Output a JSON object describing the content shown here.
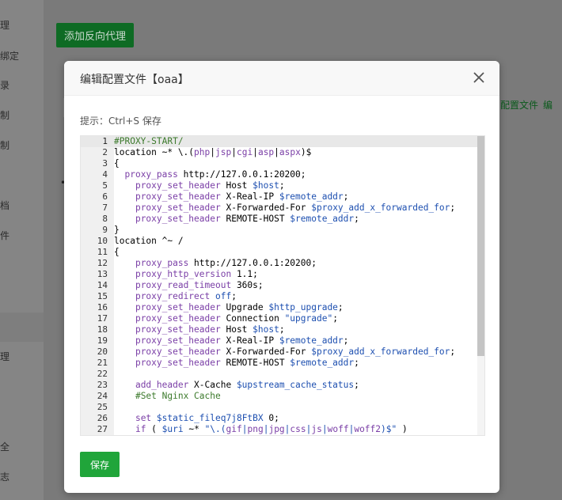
{
  "background": {
    "sidebar_items": [
      "理",
      "绑定",
      "录",
      "制",
      "制",
      "",
      "档",
      "件",
      "理",
      "全",
      "志"
    ],
    "add_button": "添加反向代理",
    "links": [
      "配置文件",
      "编"
    ],
    "bullet": "•"
  },
  "modal": {
    "title": "编辑配置文件【oaa】",
    "hint": "提示：Ctrl+S 保存",
    "save_label": "保存"
  },
  "editor": {
    "active_line": 1,
    "lines": [
      [
        [
          "cmt",
          "#PROXY-START/"
        ]
      ],
      [
        [
          "t",
          "location ~* \\.("
        ],
        [
          "kw",
          "php"
        ],
        [
          "t",
          "|"
        ],
        [
          "kw",
          "jsp"
        ],
        [
          "t",
          "|"
        ],
        [
          "kw",
          "cgi"
        ],
        [
          "t",
          "|"
        ],
        [
          "kw",
          "asp"
        ],
        [
          "t",
          "|"
        ],
        [
          "kw",
          "aspx"
        ],
        [
          "t",
          ")$"
        ]
      ],
      [
        [
          "t",
          "{"
        ]
      ],
      [
        [
          "t",
          "  "
        ],
        [
          "kw",
          "proxy_pass"
        ],
        [
          "t",
          " http://127.0.0.1:20200;"
        ]
      ],
      [
        [
          "t",
          "    "
        ],
        [
          "kw",
          "proxy_set_header"
        ],
        [
          "t",
          " Host "
        ],
        [
          "var",
          "$host"
        ],
        [
          "t",
          ";"
        ]
      ],
      [
        [
          "t",
          "    "
        ],
        [
          "kw",
          "proxy_set_header"
        ],
        [
          "t",
          " X-Real-IP "
        ],
        [
          "var",
          "$remote_addr"
        ],
        [
          "t",
          ";"
        ]
      ],
      [
        [
          "t",
          "    "
        ],
        [
          "kw",
          "proxy_set_header"
        ],
        [
          "t",
          " X-Forwarded-For "
        ],
        [
          "var",
          "$proxy_add_x_forwarded_for"
        ],
        [
          "t",
          ";"
        ]
      ],
      [
        [
          "t",
          "    "
        ],
        [
          "kw",
          "proxy_set_header"
        ],
        [
          "t",
          " REMOTE-HOST "
        ],
        [
          "var",
          "$remote_addr"
        ],
        [
          "t",
          ";"
        ]
      ],
      [
        [
          "t",
          "}"
        ]
      ],
      [
        [
          "t",
          "location ^~ /"
        ]
      ],
      [
        [
          "t",
          "{"
        ]
      ],
      [
        [
          "t",
          "    "
        ],
        [
          "kw",
          "proxy_pass"
        ],
        [
          "t",
          " http://127.0.0.1:20200;"
        ]
      ],
      [
        [
          "t",
          "    "
        ],
        [
          "kw",
          "proxy_http_version"
        ],
        [
          "t",
          " 1.1;"
        ]
      ],
      [
        [
          "t",
          "    "
        ],
        [
          "kw",
          "proxy_read_timeout"
        ],
        [
          "t",
          " 360s;"
        ]
      ],
      [
        [
          "t",
          "    "
        ],
        [
          "kw",
          "proxy_redirect"
        ],
        [
          "t",
          " "
        ],
        [
          "var",
          "off"
        ],
        [
          "t",
          ";"
        ]
      ],
      [
        [
          "t",
          "    "
        ],
        [
          "kw",
          "proxy_set_header"
        ],
        [
          "t",
          " Upgrade "
        ],
        [
          "var",
          "$http_upgrade"
        ],
        [
          "t",
          ";"
        ]
      ],
      [
        [
          "t",
          "    "
        ],
        [
          "kw",
          "proxy_set_header"
        ],
        [
          "t",
          " Connection "
        ],
        [
          "str",
          "\"upgrade\""
        ],
        [
          "t",
          ";"
        ]
      ],
      [
        [
          "t",
          "    "
        ],
        [
          "kw",
          "proxy_set_header"
        ],
        [
          "t",
          " Host "
        ],
        [
          "var",
          "$host"
        ],
        [
          "t",
          ";"
        ]
      ],
      [
        [
          "t",
          "    "
        ],
        [
          "kw",
          "proxy_set_header"
        ],
        [
          "t",
          " X-Real-IP "
        ],
        [
          "var",
          "$remote_addr"
        ],
        [
          "t",
          ";"
        ]
      ],
      [
        [
          "t",
          "    "
        ],
        [
          "kw",
          "proxy_set_header"
        ],
        [
          "t",
          " X-Forwarded-For "
        ],
        [
          "var",
          "$proxy_add_x_forwarded_for"
        ],
        [
          "t",
          ";"
        ]
      ],
      [
        [
          "t",
          "    "
        ],
        [
          "kw",
          "proxy_set_header"
        ],
        [
          "t",
          " REMOTE-HOST "
        ],
        [
          "var",
          "$remote_addr"
        ],
        [
          "t",
          ";"
        ]
      ],
      [],
      [
        [
          "t",
          "    "
        ],
        [
          "kw",
          "add_header"
        ],
        [
          "t",
          " X-Cache "
        ],
        [
          "var",
          "$upstream_cache_status"
        ],
        [
          "t",
          ";"
        ]
      ],
      [
        [
          "t",
          "    "
        ],
        [
          "cmt",
          "#Set Nginx Cache"
        ]
      ],
      [],
      [
        [
          "t",
          "    "
        ],
        [
          "kw",
          "set"
        ],
        [
          "t",
          " "
        ],
        [
          "var",
          "$static_fileq7j8FtBX"
        ],
        [
          "t",
          " 0;"
        ]
      ],
      [
        [
          "t",
          "    "
        ],
        [
          "kw",
          "if"
        ],
        [
          "t",
          " ( "
        ],
        [
          "var",
          "$uri"
        ],
        [
          "t",
          " ~* "
        ],
        [
          "str",
          "\"\\.("
        ],
        [
          "kw",
          "gif"
        ],
        [
          "str",
          "|"
        ],
        [
          "kw",
          "png"
        ],
        [
          "str",
          "|"
        ],
        [
          "kw",
          "jpg"
        ],
        [
          "str",
          "|"
        ],
        [
          "kw",
          "css"
        ],
        [
          "str",
          "|"
        ],
        [
          "kw",
          "js"
        ],
        [
          "str",
          "|"
        ],
        [
          "kw",
          "woff"
        ],
        [
          "str",
          "|"
        ],
        [
          "kw",
          "woff2"
        ],
        [
          "str",
          ")$\""
        ],
        [
          "t",
          " )"
        ]
      ]
    ]
  }
}
